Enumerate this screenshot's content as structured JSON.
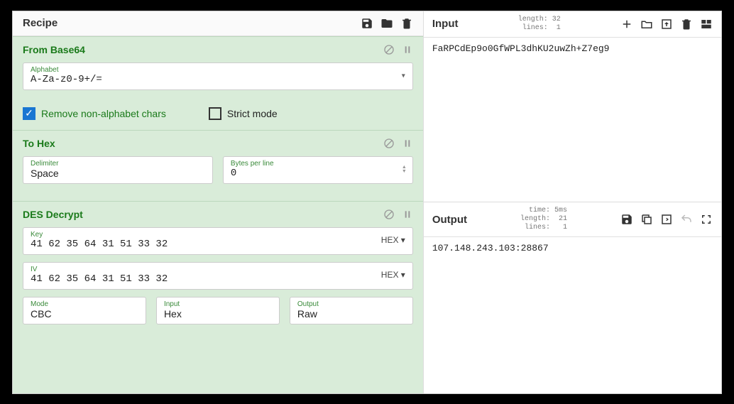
{
  "recipe": {
    "title": "Recipe",
    "ops": [
      {
        "name": "From Base64",
        "alphabet_label": "Alphabet",
        "alphabet_value": "A-Za-z0-9+/=",
        "remove_label": "Remove non-alphabet chars",
        "remove_checked": true,
        "strict_label": "Strict mode",
        "strict_checked": false
      },
      {
        "name": "To Hex",
        "delimiter_label": "Delimiter",
        "delimiter_value": "Space",
        "bpl_label": "Bytes per line",
        "bpl_value": "0"
      },
      {
        "name": "DES Decrypt",
        "key_label": "Key",
        "key_value": "41 62 35 64 31 51 33 32",
        "key_fmt": "HEX",
        "iv_label": "IV",
        "iv_value": "41 62 35 64 31 51 33 32",
        "iv_fmt": "HEX",
        "mode_label": "Mode",
        "mode_value": "CBC",
        "input_label": "Input",
        "input_value": "Hex",
        "output_label": "Output",
        "output_value": "Raw"
      }
    ]
  },
  "input": {
    "title": "Input",
    "meta": "length: 32\n lines:  1",
    "content": "FaRPCdEp9o0GfWPL3dhKU2uwZh+Z7eg9"
  },
  "output": {
    "title": "Output",
    "meta": "  time: 5ms\nlength:  21\n lines:   1",
    "content": "107.148.243.103:28867"
  }
}
